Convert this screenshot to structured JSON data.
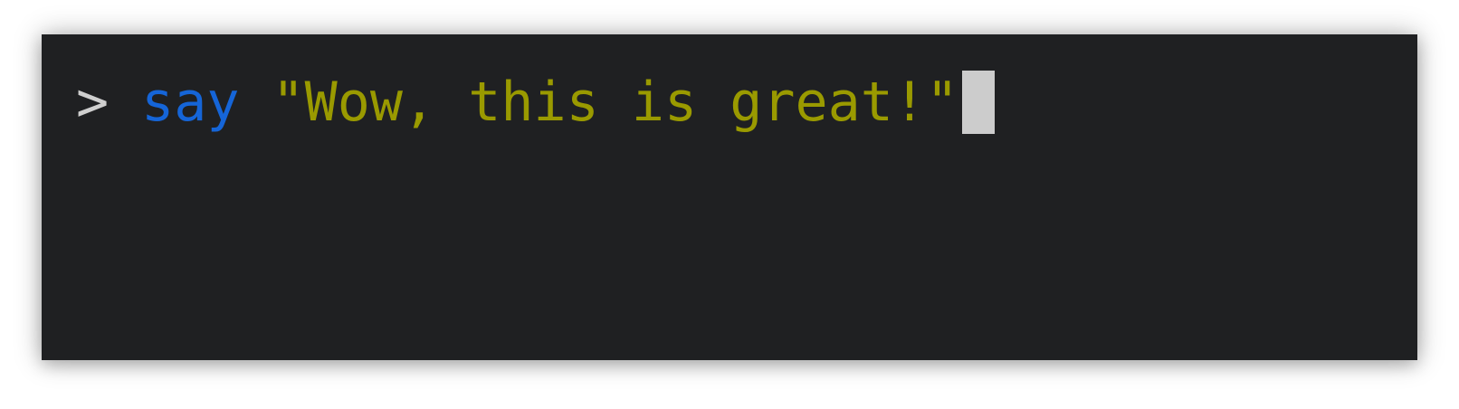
{
  "terminal": {
    "prompt_symbol": ">",
    "command_keyword": "say",
    "command_argument": "\"Wow, this is great!\"",
    "colors": {
      "background": "#1f2022",
      "prompt": "#cfcfcf",
      "keyword": "#1565d8",
      "string": "#9a9a00",
      "cursor": "#cccccc"
    }
  }
}
